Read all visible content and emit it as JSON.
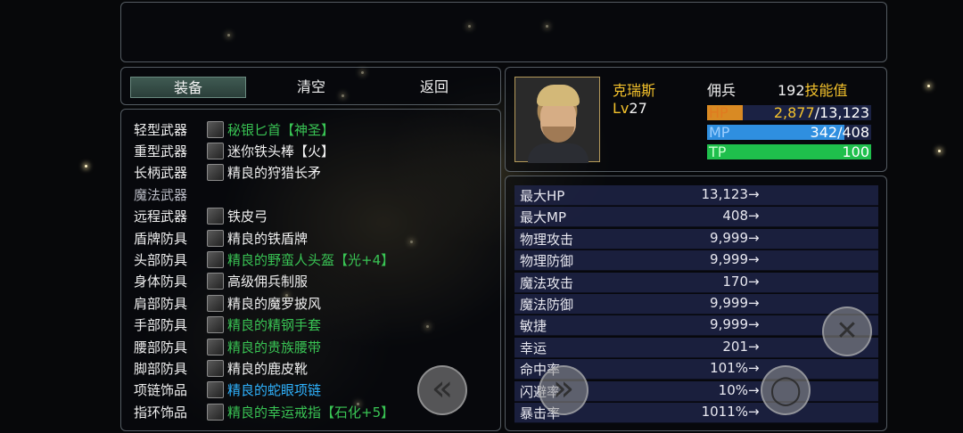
{
  "menu": {
    "equip": "装备",
    "clear": "清空",
    "back": "返回"
  },
  "slots": [
    {
      "label": "轻型武器",
      "item": "秘银匕首【神圣】",
      "color": "#39c454",
      "icon": "dagger-icon"
    },
    {
      "label": "重型武器",
      "item": "迷你铁头棒【火】",
      "color": "#f2f2f2",
      "icon": "club-icon"
    },
    {
      "label": "长柄武器",
      "item": "精良的狩猎长矛",
      "color": "#f2f2f2",
      "icon": "spear-icon"
    },
    {
      "label": "魔法武器",
      "item": "",
      "color": "#f2f2f2",
      "icon": ""
    },
    {
      "label": "远程武器",
      "item": "铁皮弓",
      "color": "#f2f2f2",
      "icon": "bow-icon"
    },
    {
      "label": "盾牌防具",
      "item": "精良的铁盾牌",
      "color": "#f2f2f2",
      "icon": "shield-icon"
    },
    {
      "label": "头部防具",
      "item": "精良的野蛮人头盔【光+4】",
      "color": "#39c454",
      "icon": "helmet-icon"
    },
    {
      "label": "身体防具",
      "item": "高级佣兵制服",
      "color": "#f2f2f2",
      "icon": "armor-icon"
    },
    {
      "label": "肩部防具",
      "item": "精良的魔罗披风",
      "color": "#f2f2f2",
      "icon": "cloak-icon"
    },
    {
      "label": "手部防具",
      "item": "精良的精钢手套",
      "color": "#39c454",
      "icon": "gauntlet-icon"
    },
    {
      "label": "腰部防具",
      "item": "精良的贵族腰带",
      "color": "#39c454",
      "icon": "belt-icon"
    },
    {
      "label": "脚部防具",
      "item": "精良的鹿皮靴",
      "color": "#f2f2f2",
      "icon": "boots-icon"
    },
    {
      "label": "项链饰品",
      "item": "精良的蛇眼项链",
      "color": "#2fb3ff",
      "icon": "necklace-icon"
    },
    {
      "label": "指环饰品",
      "item": "精良的幸运戒指【石化+5】",
      "color": "#39c454",
      "icon": "ring-icon"
    }
  ],
  "character": {
    "name": "克瑞斯",
    "class": "佣兵",
    "level_prefix": "Lv",
    "level": "27",
    "skill_points": "192",
    "skill_points_label": "技能值",
    "hp_label": "HP",
    "hp_current": "2,877",
    "hp_max": "/13,123",
    "hp_fraction": 0.219,
    "mp_label": "MP",
    "mp_value": "342/408",
    "mp_fraction": 0.838,
    "tp_label": "TP",
    "tp_value": "100",
    "tp_fraction": 1.0,
    "colors": {
      "name": "#f4c22c",
      "skill": "#f4c22c",
      "hp_bar": "#d98a23",
      "mp_bar": "#2f8fe0",
      "tp_bar": "#1fbf4c"
    }
  },
  "stats": [
    {
      "name": "最大HP",
      "value": "13,123"
    },
    {
      "name": "最大MP",
      "value": "408"
    },
    {
      "name": "物理攻击",
      "value": "9,999"
    },
    {
      "name": "物理防御",
      "value": "9,999"
    },
    {
      "name": "魔法攻击",
      "value": "170"
    },
    {
      "name": "魔法防御",
      "value": "9,999"
    },
    {
      "name": "敏捷",
      "value": "9,999"
    },
    {
      "name": "幸运",
      "value": "201"
    },
    {
      "name": "命中率",
      "value": "101%"
    },
    {
      "name": "闪避率",
      "value": "10%"
    },
    {
      "name": "暴击率",
      "value": "1011%"
    }
  ],
  "stat_arrow": "→",
  "controls": {
    "left_glyph": "«",
    "right_glyph": "»",
    "close_glyph": "✕",
    "confirm_glyph": "◯"
  }
}
